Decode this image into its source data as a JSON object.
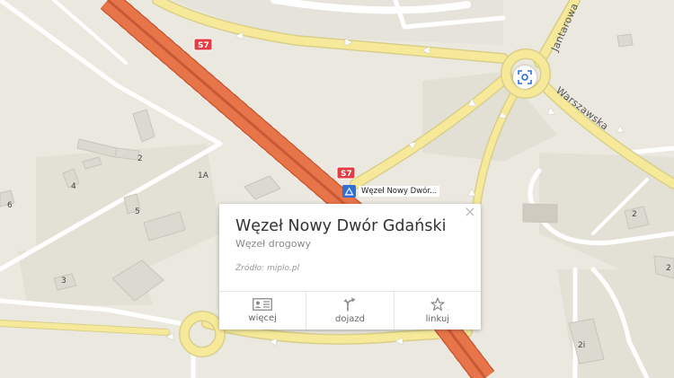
{
  "map": {
    "road_shields": [
      "S7",
      "S7"
    ],
    "street_names": [
      "Jantarowa",
      "Warszawska"
    ],
    "house_numbers": [
      "2",
      "4",
      "1A",
      "5",
      "6",
      "3",
      "2",
      "2",
      "2i"
    ],
    "colors": {
      "background": "#ebe8df",
      "expressway": "#e8754a",
      "main_road": "#f6ea9a",
      "minor_road": "#ffffff",
      "building": "#dcd9d0",
      "shield": "#e23d44",
      "poi_blue": "#2f6fd6"
    }
  },
  "poi": {
    "label": "Węzeł Nowy Dwór...",
    "icon": "road-junction-icon"
  },
  "locate_button": {
    "icon": "locate-icon"
  },
  "popup": {
    "title": "Węzeł Nowy Dwór Gdański",
    "subtitle": "Węzeł drogowy",
    "source": "Źródło: miplo.pl",
    "close_label": "×",
    "actions": [
      {
        "label": "więcej",
        "icon": "info-card-icon"
      },
      {
        "label": "dojazd",
        "icon": "directions-icon"
      },
      {
        "label": "linkuj",
        "icon": "star-icon"
      }
    ]
  }
}
